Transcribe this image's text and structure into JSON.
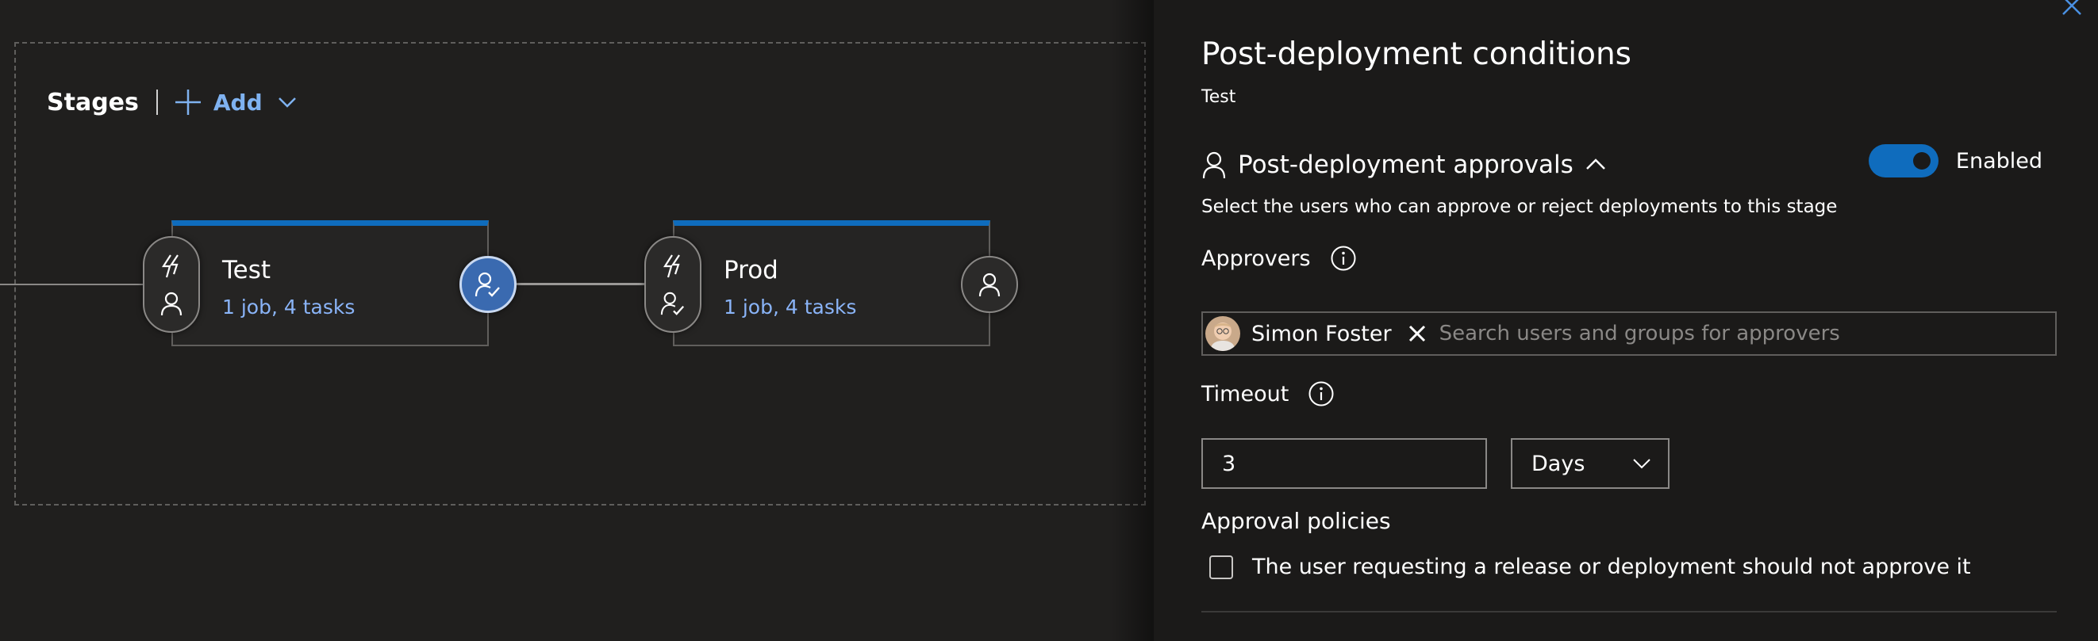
{
  "pipeline": {
    "stages_title": "Stages",
    "add_label": "Add",
    "stages": [
      {
        "name": "Test",
        "info": "1 job, 4 tasks",
        "post_approval_active": true
      },
      {
        "name": "Prod",
        "info": "1 job, 4 tasks",
        "post_approval_active": false
      }
    ]
  },
  "panel": {
    "title": "Post-deployment conditions",
    "subtitle": "Test",
    "approvals": {
      "title": "Post-deployment approvals",
      "enabled": true,
      "toggle_label": "Enabled",
      "description": "Select the users who can approve or reject deployments to this stage",
      "approvers_label": "Approvers",
      "approver_name": "Simon Foster",
      "search_placeholder": "Search users and groups for approvers",
      "timeout_label": "Timeout",
      "timeout_value": "3",
      "timeout_unit": "Days",
      "policies_title": "Approval policies",
      "policy_option": "The user requesting a release or deployment should not approve it",
      "policy_checked": false
    }
  },
  "colors": {
    "accent": "#0f6cbd",
    "link": "#8ab4f8",
    "background": "#201f1e",
    "panel_background": "#1b1a19"
  },
  "icons": {
    "add": "plus-icon",
    "add_menu": "chevron-down-icon",
    "pre_trigger": "lightning-icon",
    "pre_approver": "person-icon",
    "post_approver_active": "person-check-icon",
    "post_approver_idle": "person-icon",
    "close": "close-icon",
    "section": "person-icon",
    "collapse": "chevron-up-icon",
    "info": "info-icon",
    "remove": "close-icon",
    "unit_menu": "chevron-down-icon"
  }
}
